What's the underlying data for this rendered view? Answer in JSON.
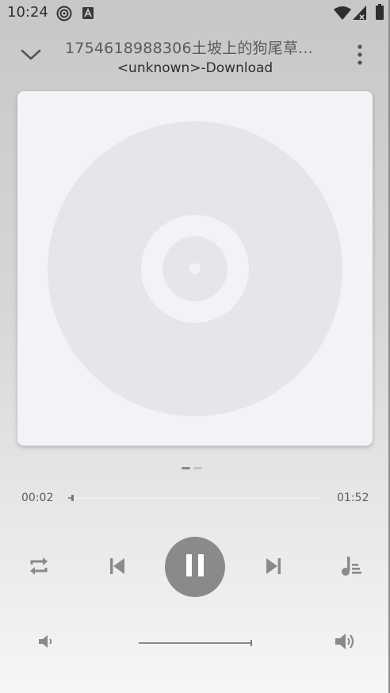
{
  "status_bar": {
    "time": "10:24",
    "icons": [
      "target-icon",
      "a-notification-icon",
      "wifi-icon",
      "signal-icon",
      "battery-icon"
    ]
  },
  "header": {
    "title": "1754618988306土坡上的狗尾草...",
    "subtitle": "<unknown>-Download",
    "collapse_icon": "chevron-down-icon",
    "more_icon": "more-vert-icon"
  },
  "artwork": {
    "icon": "vinyl-disc-icon"
  },
  "pager": {
    "count": 2,
    "active_index": 0
  },
  "playback": {
    "elapsed": "00:02",
    "duration": "01:52",
    "progress_fraction": 0.018
  },
  "controls": {
    "repeat_icon": "repeat-icon",
    "previous_icon": "skip-previous-icon",
    "play_state_icon": "pause-icon",
    "next_icon": "skip-next-icon",
    "playlist_icon": "queue-music-icon"
  },
  "volume": {
    "low_icon": "volume-low-icon",
    "high_icon": "volume-high-icon",
    "level_fraction": 1.0
  },
  "colors": {
    "control_gray": "#8a8a8a",
    "art_background": "#f2f3f6",
    "disc_gray": "#e5e6e9",
    "pager_active": "#888888",
    "pager_inactive": "#c4c4c4"
  }
}
